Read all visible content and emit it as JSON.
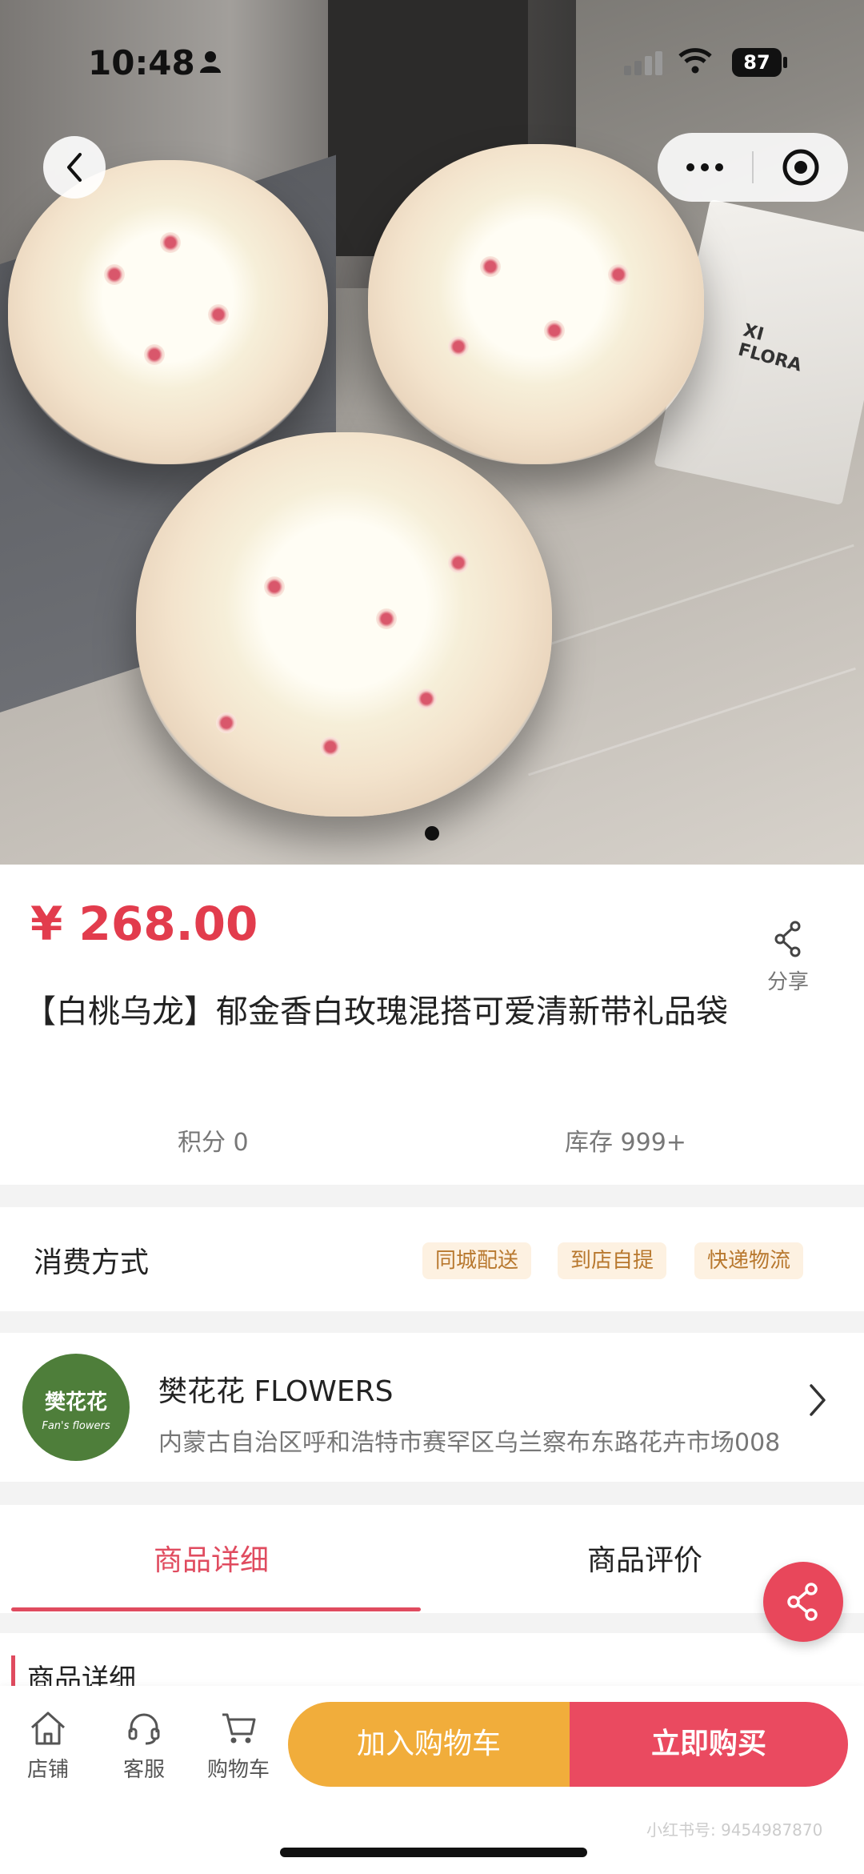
{
  "status_bar": {
    "time": "10:48",
    "battery": "87"
  },
  "product": {
    "price": "¥ 268.00",
    "title": "【白桃乌龙】郁金香白玫瑰混搭可爱清新带礼品袋",
    "share_label": "分享",
    "points": "积分 0",
    "stock": "库存 999+"
  },
  "hero": {
    "bag_text_line1": "XI",
    "bag_text_line2": "FLORA"
  },
  "consumption": {
    "label": "消费方式",
    "options": [
      "同城配送",
      "到店自提",
      "快递物流"
    ]
  },
  "store": {
    "logo_cn": "樊花花",
    "logo_en": "Fan's flowers",
    "name": "樊花花 FLOWERS",
    "address": "内蒙古自治区呼和浩特市赛罕区乌兰察布东路花卉市场008"
  },
  "tabs": [
    {
      "label": "商品详细",
      "active": true
    },
    {
      "label": "商品评价",
      "active": false
    }
  ],
  "detail": {
    "heading": "商品详细"
  },
  "bottom_nav": [
    {
      "label": "店铺",
      "icon": "home-icon"
    },
    {
      "label": "客服",
      "icon": "headset-icon"
    },
    {
      "label": "购物车",
      "icon": "cart-icon"
    }
  ],
  "actions": {
    "add_to_cart": "加入购物车",
    "buy_now": "立即购买"
  },
  "watermark": "小红书号: 9454987870",
  "colors": {
    "accent": "#e04b5f",
    "price": "#e23c4d",
    "cart": "#f1ad3b",
    "buy": "#ea4a60"
  }
}
